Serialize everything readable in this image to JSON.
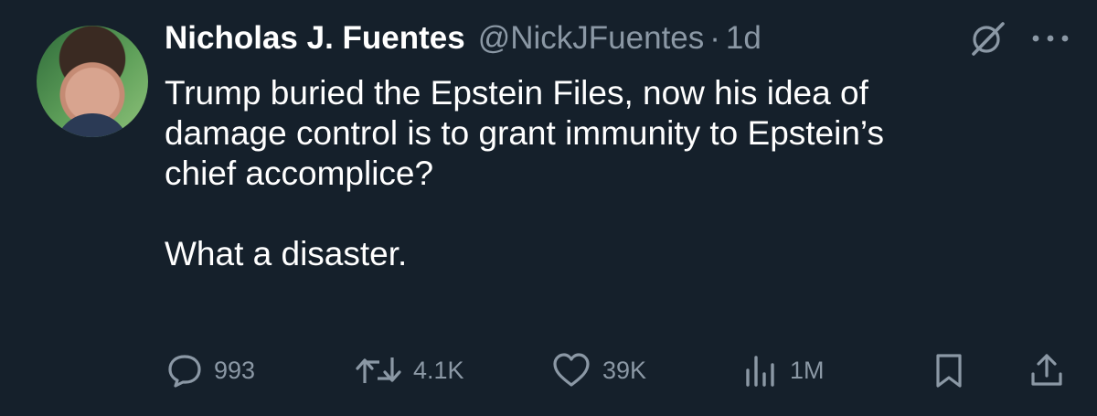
{
  "author": {
    "name": "Nicholas J. Fuentes",
    "handle": "@NickJFuentes",
    "separator": "·",
    "time": "1d"
  },
  "tweet": {
    "text": "Trump buried the Epstein Files, now his idea of\ndamage control is to grant immunity to Epstein’s\nchief accomplice?\n\nWhat a disaster."
  },
  "actions": {
    "replies": "993",
    "retweets": "4.1K",
    "likes": "39K",
    "views": "1M"
  },
  "icons": {
    "grok": "grok-icon",
    "more": "more-icon",
    "reply": "reply-icon",
    "retweet": "retweet-icon",
    "like": "heart-icon",
    "views": "views-icon",
    "bookmark": "bookmark-icon",
    "share": "share-icon"
  },
  "colors": {
    "background": "#15202b",
    "text": "#ffffff",
    "secondary": "#8b98a5"
  }
}
